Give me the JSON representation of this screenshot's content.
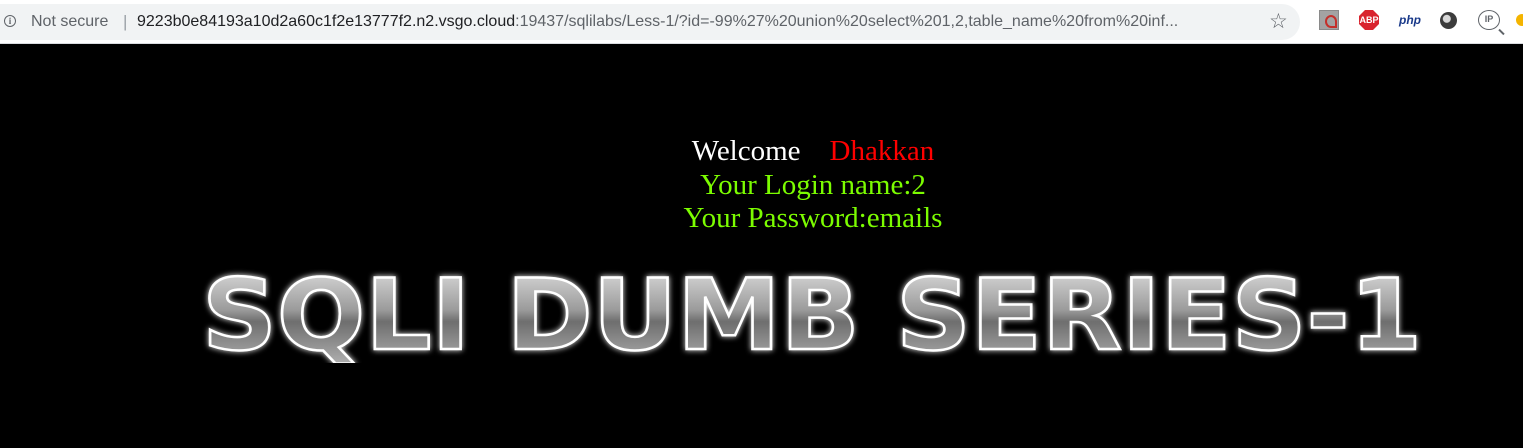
{
  "browser": {
    "security_label": "Not secure",
    "separator": "|",
    "url_host": "9223b0e84193a10d2a60c1f2e13777f2.n2.vsgo.cloud",
    "url_rest": ":19437/sqlilabs/Less-1/?id=-99%27%20union%20select%201,2,table_name%20from%20inf...",
    "bookmark_icon": "star-icon",
    "extensions": [
      {
        "icon": "pdf-extension-icon",
        "label": ""
      },
      {
        "icon": "adblock-plus-icon",
        "label": "ABP"
      },
      {
        "icon": "php-extension-icon",
        "label": "php"
      },
      {
        "icon": "circle-extension-icon",
        "label": ""
      },
      {
        "icon": "ip-extension-icon",
        "label": "IP"
      }
    ]
  },
  "page": {
    "welcome_word": "Welcome",
    "welcome_name": "Dhakkan",
    "login_text": "Your Login name:2",
    "password_text": "Your Password:emails",
    "banner_text": "SQLI DUMB SERIES-1"
  },
  "colors": {
    "background": "#000000",
    "welcome": "#ffffff",
    "name": "#ff0000",
    "result": "#7cfc00"
  }
}
